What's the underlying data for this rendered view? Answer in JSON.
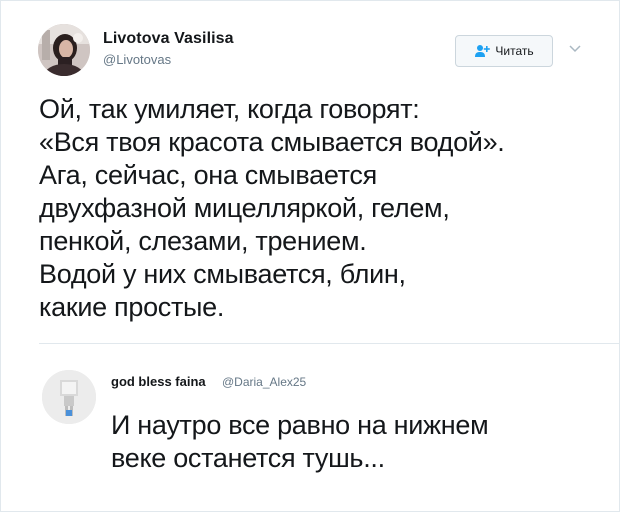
{
  "tweet": {
    "author": {
      "name": "Livotova Vasilisa",
      "handle": "@Livotovas"
    },
    "follow_label": "Читать",
    "lines": [
      "Ой, так умиляет, когда говорят:",
      "«Вся твоя красота смывается водой».",
      "Ага, сейчас, она смывается",
      "двухфазной мицелляркой, гелем,",
      "пенкой, слезами, трением.",
      "Водой у них смывается, блин,",
      "какие простые."
    ]
  },
  "reply": {
    "author": {
      "name": "god bless faina",
      "handle": "@Daria_Alex25"
    },
    "lines": [
      "И наутро все равно на нижнем",
      "веке останется тушь..."
    ]
  },
  "colors": {
    "text": "#14171a",
    "secondary": "#657786",
    "accent": "#1da1f2",
    "border": "#e1e8ed"
  },
  "icons": {
    "follow": "person-plus-icon",
    "caret": "chevron-down-icon"
  }
}
